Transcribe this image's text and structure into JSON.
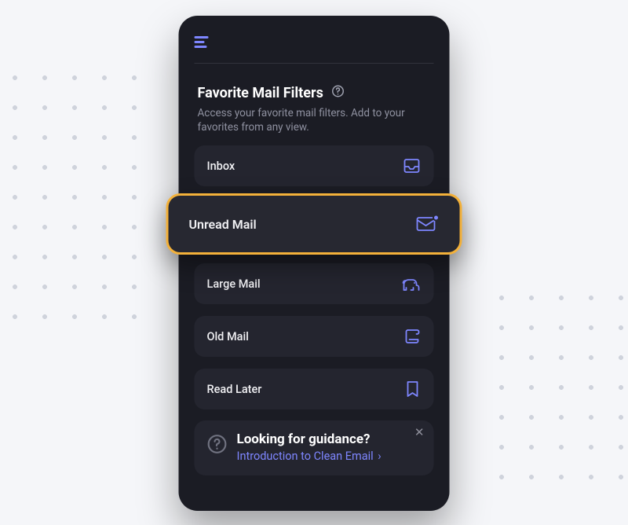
{
  "colors": {
    "accent": "#7e86ff",
    "highlightBorder": "#f3b13a",
    "panel": "#1b1c24",
    "card": "#24252f"
  },
  "section": {
    "title": "Favorite Mail Filters",
    "sub": "Access your favorite mail filters. Add to your favorites from any view."
  },
  "filters": [
    {
      "label": "Inbox",
      "icon": "inbox-icon"
    },
    {
      "label": "Unread Mail",
      "icon": "unread-mail-icon",
      "highlighted": true
    },
    {
      "label": "Large Mail",
      "icon": "elephant-icon"
    },
    {
      "label": "Old Mail",
      "icon": "scroll-icon"
    },
    {
      "label": "Read Later",
      "icon": "bookmark-icon"
    }
  ],
  "footer": {
    "title": "Looking for guidance?",
    "link": "Introduction to Clean Email"
  },
  "close_label": "✕"
}
